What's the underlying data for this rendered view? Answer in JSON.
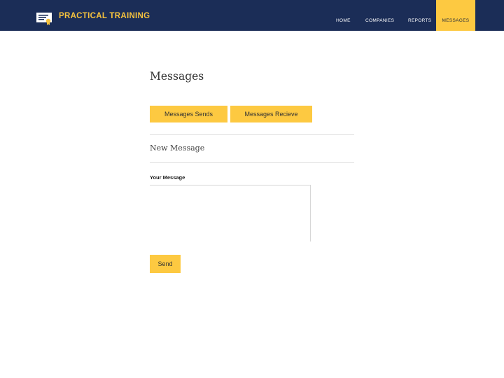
{
  "header": {
    "brand_icon": "certificate-icon",
    "brand_title": "PRACTICAL TRAINING",
    "nav": {
      "home": "HOME",
      "companies": "COMPANIES",
      "reports": "REPORTS",
      "messages": "MESSAGES"
    },
    "active_nav": "messages"
  },
  "main": {
    "title": "Messages",
    "tabs": {
      "sends": "Messages Sends",
      "receive": "Messages Recieve"
    },
    "section_title": "New Message",
    "message_label": "Your Message",
    "message_value": "",
    "send_label": "Send"
  },
  "colors": {
    "header_bg": "#1b2d57",
    "accent": "#fdc941",
    "brand_text": "#f6c23e"
  }
}
